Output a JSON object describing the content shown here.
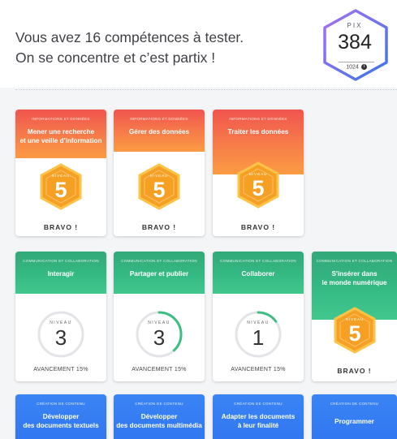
{
  "header": {
    "intro_line1": "Vous avez 16 compétences à tester.",
    "intro_line2": "On se concentre et c’est partix !",
    "pix_label": "PIX",
    "pix_score": "384",
    "pix_max": "1024"
  },
  "colors": {
    "orange": "#f47048",
    "green": "#35b981",
    "blue": "#3580f3",
    "hex_gold": "#f8a521",
    "pix_badge_gradient": [
      "#a770f2",
      "#3d75e8"
    ]
  },
  "cards": [
    {
      "area": "INFORMATIONS ET DONNÉES",
      "title": "Mener une recherche\net une veille d'information",
      "level_label": "NIVEAU",
      "level": "5",
      "status": "BRAVO !"
    },
    {
      "area": "INFORMATIONS ET DONNÉES",
      "title": "Gérer des données",
      "level_label": "NIVEAU",
      "level": "5",
      "status": "BRAVO !"
    },
    {
      "area": "INFORMATIONS ET DONNÉES",
      "title": "Traiter les données",
      "level_label": "NIVEAU",
      "level": "5",
      "status": "BRAVO !"
    },
    {
      "area": "COMMUNICATION ET COLLABORATION",
      "title": "Interagir",
      "level_label": "NIVEAU",
      "level": "3",
      "status": "AVANCEMENT 15%",
      "progress": 0.0
    },
    {
      "area": "COMMUNICATION ET COLLABORATION",
      "title": "Partager et publier",
      "level_label": "NIVEAU",
      "level": "3",
      "status": "AVANCEMENT 15%",
      "progress": 0.38
    },
    {
      "area": "COMMUNICATION ET COLLABORATION",
      "title": "Collaborer",
      "level_label": "NIVEAU",
      "level": "1",
      "status": "AVANCEMENT 15%",
      "progress": 0.15
    },
    {
      "area": "COMMUNICATION ET COLLABORATION",
      "title": "S'insérer dans\nle monde numérique",
      "level_label": "NIVEAU",
      "level": "5",
      "status": "BRAVO !"
    },
    {
      "area": "CRÉATION DE CONTENU",
      "title": "Développer\ndes documents textuels"
    },
    {
      "area": "CRÉATION DE CONTENU",
      "title": "Développer\ndes documents multimédia"
    },
    {
      "area": "CRÉATION DE CONTENU",
      "title": "Adapter les documents\nà leur finalité"
    },
    {
      "area": "CRÉATION DE CONTENU",
      "title": "Programmer"
    }
  ]
}
